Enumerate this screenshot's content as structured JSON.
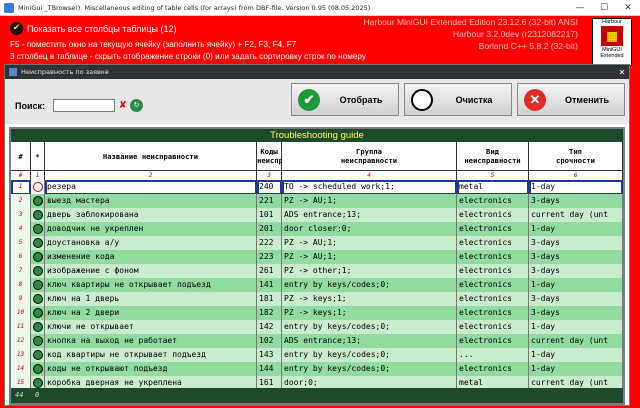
{
  "titlebar": {
    "title": "MiniGui _TBrowse(). Miscellaneous editing of table cells (for arrays) from DBF-file.  Version 0.95 (08.05.2025)",
    "minimize": "—",
    "maximize": "☐",
    "close": "✕"
  },
  "main": {
    "show_columns_label": "Показать все столбцы таблицы (12)",
    "show_columns_checked": true,
    "hint1": "F5 - поместить окно на текущую ячейку (заполнить ячейку) + F2, F3, F4, F7",
    "hint2": "3 столбец в таблице - скрыть отображение строки (0) или задать сортировку строк по номеру",
    "info": [
      "Harbour MiniGUI Extended Edition 23.12.6 (32-bit) ANSI",
      "Harbour 3.2.0dev (r2312082217)",
      "Borland C++ 5.8.2 (32-bit)"
    ],
    "logo_text": [
      "Harbour",
      "MiniGUI",
      "Extended"
    ]
  },
  "subwindow": {
    "title": "Неисправность по заявке",
    "search_label": "Поиск:",
    "search_value": "",
    "buttons": {
      "select": "Отобрать",
      "clear": "Очистка",
      "cancel": "Отменить"
    }
  },
  "grid": {
    "caption": "Troubleshooting guide",
    "headers": {
      "no": "#",
      "mark": "*",
      "name": "Название неисправности",
      "code": [
        "Коды",
        "неиспр"
      ],
      "group": [
        "Группа",
        "неисправности"
      ],
      "kind": [
        "Вид",
        "неисправности"
      ],
      "term": [
        "Тип",
        "срочности"
      ]
    },
    "colnums": [
      "#",
      "1",
      "2",
      "3",
      "4",
      "5",
      "6"
    ],
    "rows": [
      {
        "no": "1",
        "name": "резера",
        "code": "240",
        "group": "TO -> scheduled work;1;",
        "kind": "metal",
        "term": "1-day"
      },
      {
        "no": "2",
        "name": "выезд мастера",
        "code": "221",
        "group": "PZ -> AU;1;",
        "kind": "electronics",
        "term": "3-days"
      },
      {
        "no": "3",
        "name": "дверь заблокирована",
        "code": "101",
        "group": "ADS entrance;13;",
        "kind": "electronics",
        "term": "current day (unt"
      },
      {
        "no": "4",
        "name": "доводчик не укреплен",
        "code": "201",
        "group": "door closer;0;",
        "kind": "electronics",
        "term": "1-day"
      },
      {
        "no": "5",
        "name": "доустановка а/у",
        "code": "222",
        "group": "PZ -> AU;1;",
        "kind": "electronics",
        "term": "3-days"
      },
      {
        "no": "6",
        "name": "изменение кода",
        "code": "223",
        "group": "PZ -> AU;1;",
        "kind": "electronics",
        "term": "3-days"
      },
      {
        "no": "7",
        "name": "изображение с фоном",
        "code": "261",
        "group": "PZ -> other;1;",
        "kind": "electronics",
        "term": "3-days"
      },
      {
        "no": "8",
        "name": "ключ квартиры не открывает подъезд",
        "code": "141",
        "group": "entry by keys/codes;0;",
        "kind": "electronics",
        "term": "1-day"
      },
      {
        "no": "9",
        "name": "ключ на 1 дверь",
        "code": "181",
        "group": "PZ -> keys;1;",
        "kind": "electronics",
        "term": "3-days"
      },
      {
        "no": "10",
        "name": "ключ на 2 двери",
        "code": "182",
        "group": "PZ -> keys;1;",
        "kind": "electronics",
        "term": "3-days"
      },
      {
        "no": "11",
        "name": "ключи не открывает",
        "code": "142",
        "group": "entry by keys/codes;0;",
        "kind": "electronics",
        "term": "1-day"
      },
      {
        "no": "12",
        "name": "кнопка на выход не работает",
        "code": "102",
        "group": "ADS entrance;13;",
        "kind": "electronics",
        "term": "current day (unt"
      },
      {
        "no": "13",
        "name": "код квартиры не открывает подъезд",
        "code": "143",
        "group": "entry by keys/codes;0;",
        "kind": "...",
        "term": "1-day"
      },
      {
        "no": "14",
        "name": "коды не открывают подъезд",
        "code": "144",
        "group": "entry by keys/codes;0;",
        "kind": "electronics",
        "term": "1-day"
      },
      {
        "no": "15",
        "name": "коробка дверная не укреплена",
        "code": "161",
        "group": "door;0;",
        "kind": "metal",
        "term": "current day (unt"
      }
    ],
    "footer": {
      "count": "44",
      "marked": "0"
    },
    "colors": {
      "row_even": "#c9eccf",
      "row_odd": "#92dba0",
      "header_bg": "#ffffff",
      "grid_bg": "#1d4a2c",
      "selection": "#1f3a8c",
      "app_bg": "#ff0000"
    }
  }
}
